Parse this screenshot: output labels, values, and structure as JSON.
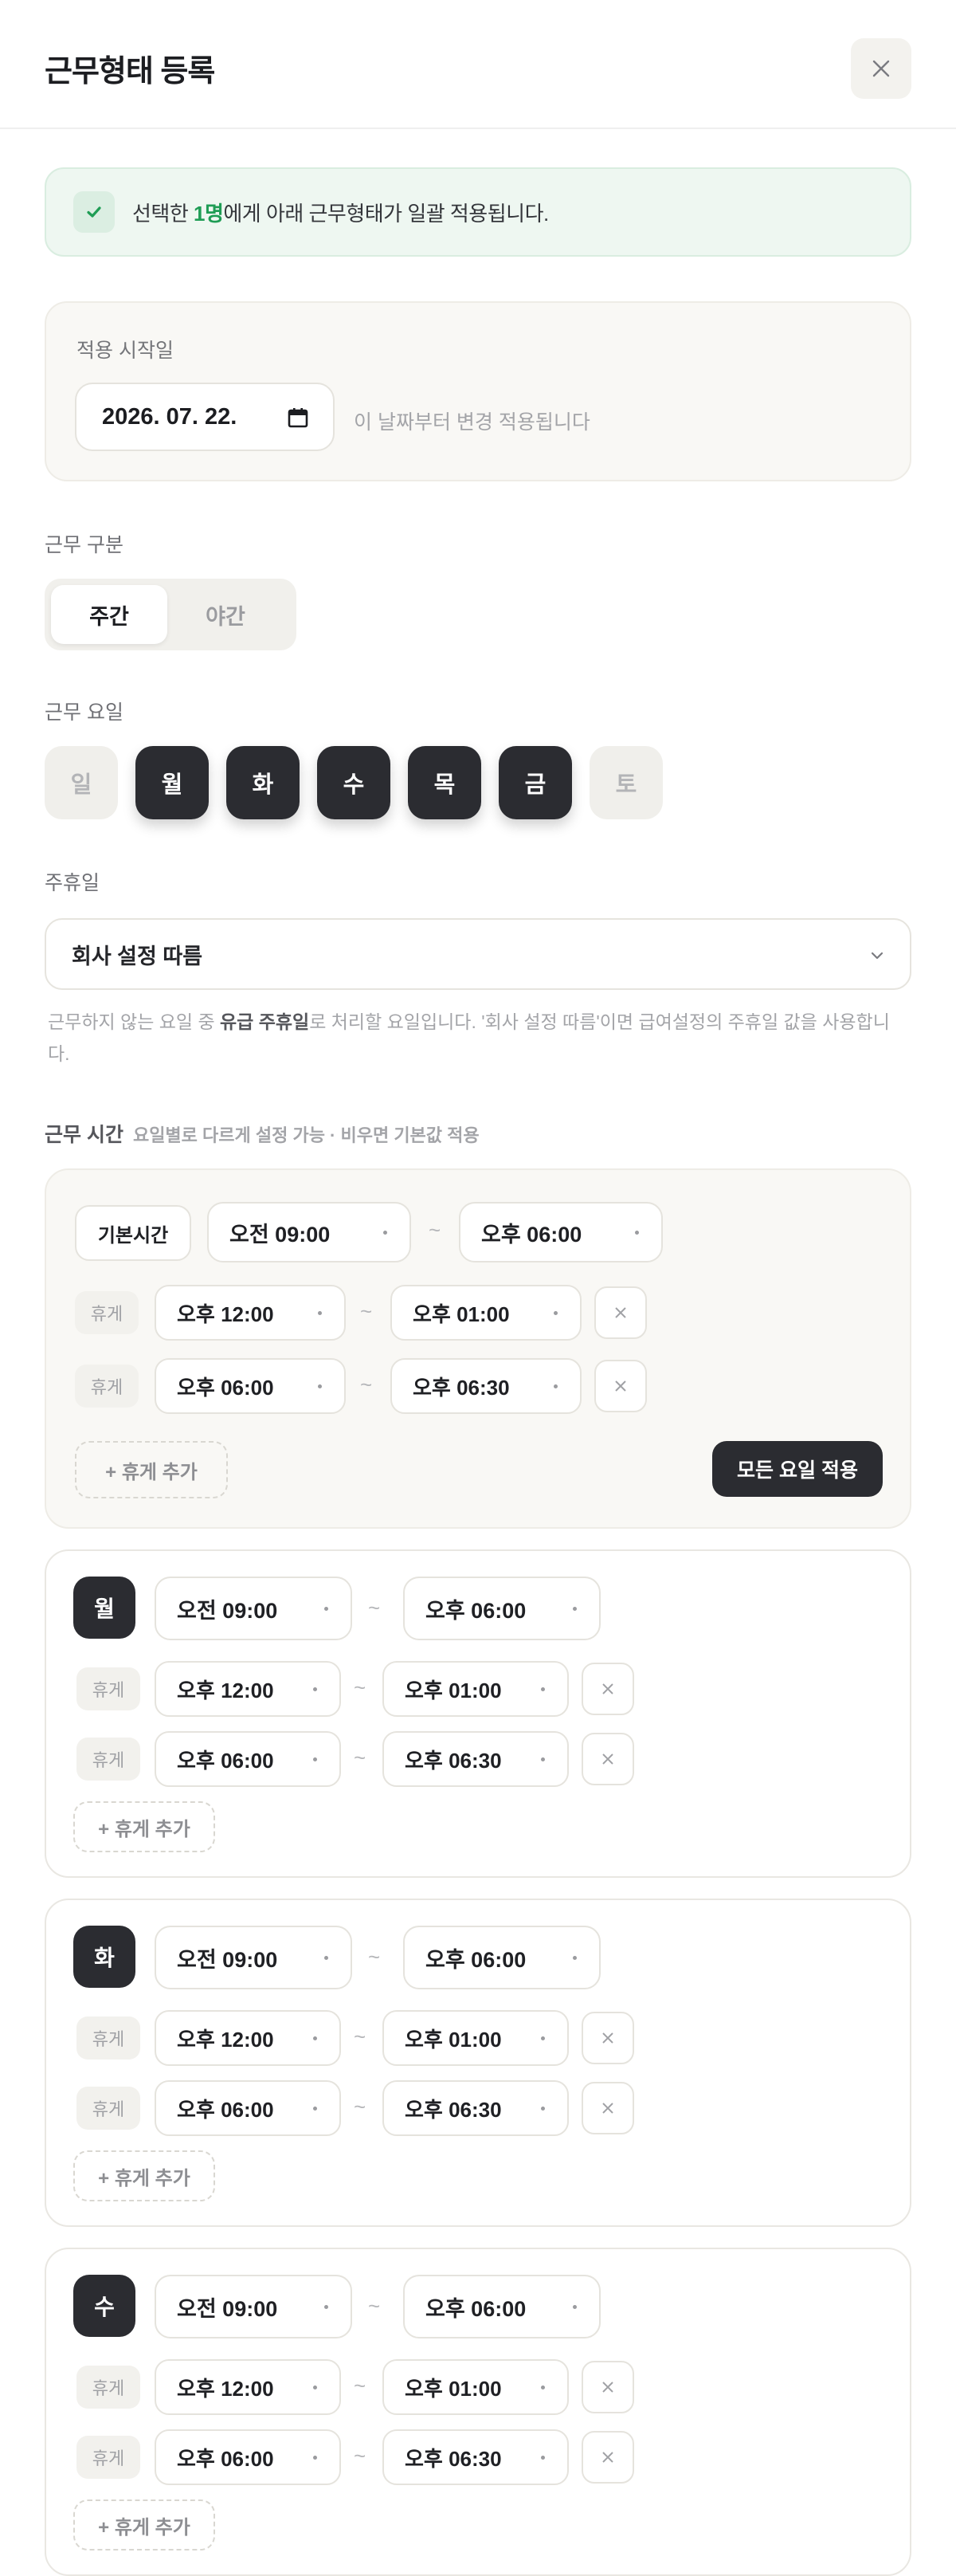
{
  "header": {
    "title": "근무형태 등록",
    "close_icon": "close-icon"
  },
  "notice": {
    "prefix": "선택한 ",
    "count": "1명",
    "suffix": "에게 아래 근무형태가 일괄 적용됩니다.",
    "color": "#1f9d55"
  },
  "start": {
    "label": "적용 시작일",
    "value": "2026. 07. 22.",
    "hint": "이 날짜부터 변경 적용됩니다"
  },
  "work_type": {
    "label": "근무 구분",
    "options": [
      "주간",
      "야간"
    ],
    "selected": "주간"
  },
  "work_days": {
    "label": "근무 요일",
    "days": [
      {
        "label": "일",
        "on": false
      },
      {
        "label": "월",
        "on": true
      },
      {
        "label": "화",
        "on": true
      },
      {
        "label": "수",
        "on": true
      },
      {
        "label": "목",
        "on": true
      },
      {
        "label": "금",
        "on": true
      },
      {
        "label": "토",
        "on": false
      }
    ]
  },
  "holiday": {
    "label": "주휴일",
    "value": "회사 설정 따름",
    "help_a": "근무하지 않는 요일 중 ",
    "help_b": "유급 주휴일",
    "help_c": "로 처리할 요일입니다. '회사 설정 따름'이면 급여설정의 주휴일 값을 사용합니다."
  },
  "work_time": {
    "label": "근무 시간",
    "sub": "요일별로 다르게 설정 가능 · 비우면 기본값 적용",
    "default": {
      "tag": "기본시간",
      "start": "오전 09:00",
      "end": "오후 06:00",
      "tilde": "~",
      "break_label": "휴게",
      "breaks": [
        {
          "start": "오후 12:00",
          "end": "오후 01:00"
        },
        {
          "start": "오후 06:00",
          "end": "오후 06:30"
        }
      ],
      "add_break": "+ 휴게 추가",
      "apply_all": "모든 요일 적용"
    },
    "days": [
      {
        "day": "월",
        "start": "오전 09:00",
        "end": "오후 06:00",
        "breaks": [
          {
            "start": "오후 12:00",
            "end": "오후 01:00"
          },
          {
            "start": "오후 06:00",
            "end": "오후 06:30"
          }
        ],
        "add_break": "+ 휴게 추가"
      },
      {
        "day": "화",
        "start": "오전 09:00",
        "end": "오후 06:00",
        "breaks": [
          {
            "start": "오후 12:00",
            "end": "오후 01:00"
          },
          {
            "start": "오후 06:00",
            "end": "오후 06:30"
          }
        ],
        "add_break": "+ 휴게 추가"
      },
      {
        "day": "수",
        "start": "오전 09:00",
        "end": "오후 06:00",
        "breaks": [
          {
            "start": "오후 12:00",
            "end": "오후 01:00"
          },
          {
            "start": "오후 06:00",
            "end": "오후 06:30"
          }
        ],
        "add_break": "+ 휴게 추가"
      }
    ]
  }
}
